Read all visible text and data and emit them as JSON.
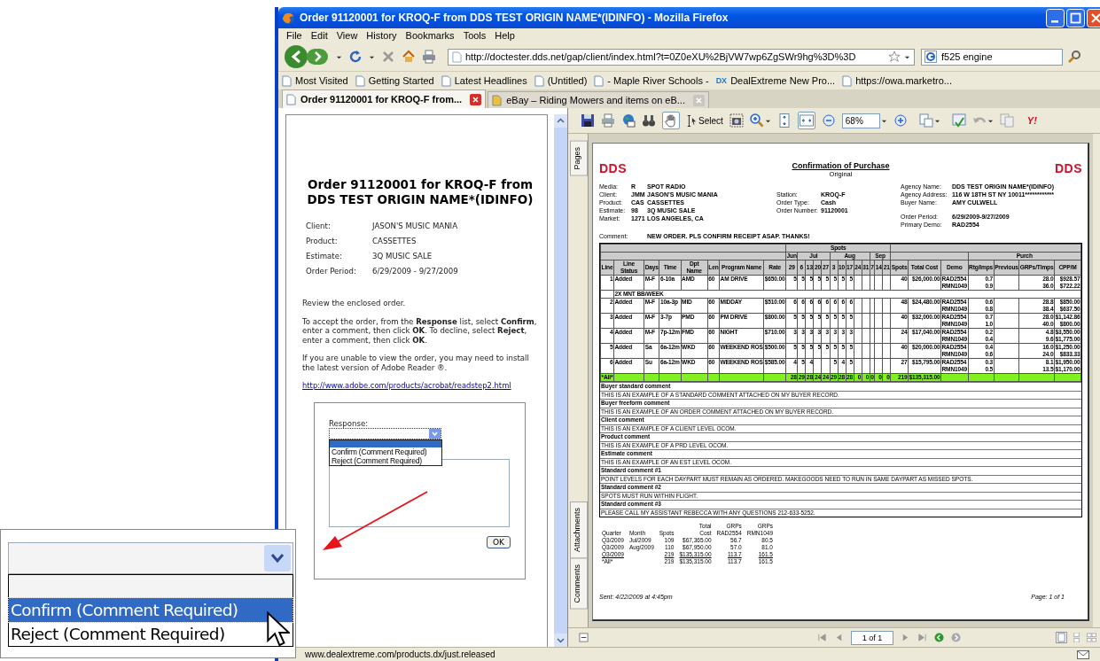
{
  "window": {
    "title": "Order 91120001 for KROQ-F from DDS TEST ORIGIN NAME*(IDINFO) - Mozilla Firefox"
  },
  "menu": [
    "File",
    "Edit",
    "View",
    "History",
    "Bookmarks",
    "Tools",
    "Help"
  ],
  "nav": {
    "url": "http://doctester.dds.net/gap/client/index.html?t=0Z0eXU%2BjVW7wp6ZgSWr9hg%3D%3D",
    "search": "f525 engine"
  },
  "bookmarks": [
    {
      "label": "Most Visited"
    },
    {
      "label": "Getting Started"
    },
    {
      "label": "Latest Headlines"
    },
    {
      "label": "(Untitled)"
    },
    {
      "label": "- Maple River Schools -"
    },
    {
      "label": "DealExtreme New Pro...",
      "badge": "DX"
    },
    {
      "label": "https://owa.marketro..."
    }
  ],
  "tabs": [
    {
      "label": "Order 91120001 for KROQ-F from...",
      "selected": true
    },
    {
      "label": "eBay – Riding Mowers and items on eB...",
      "selected": false
    }
  ],
  "order_page": {
    "heading": "Order 91120001 for KROQ-F from DDS TEST ORIGIN NAME*(IDINFO)",
    "fields": [
      {
        "label": "Client:",
        "value": "JASON'S MUSIC MANIA"
      },
      {
        "label": "Product:",
        "value": "CASSETTES"
      },
      {
        "label": "Estimate:",
        "value": "3Q MUSIC SALE"
      },
      {
        "label": "Order Period:",
        "value": "6/29/2009 - 9/27/2009"
      }
    ],
    "paragraphs": [
      "Review the enclosed order.",
      "To accept the order, from the **Response** list, select **Confirm**, enter a comment, then click **OK**. To decline, select **Reject**, enter a comment, then click **OK**.",
      "If you are unable to view the order, you may need to install the latest version of Adobe Reader ®."
    ],
    "link": "http://www.adobe.com/products/acrobat/readstep2.html",
    "response": {
      "label": "Response:",
      "blank_highlighted": true,
      "options": [
        {
          "label": "Confirm (Comment Required)",
          "selected": false
        },
        {
          "label": "Reject (Comment Required)",
          "selected": false
        }
      ],
      "button": "OK"
    }
  },
  "pdf_viewer": {
    "toolbar": {
      "hand_selected": true,
      "select_label": "Select",
      "fit_width_selected": true,
      "zoom": "68%",
      "logo": "Y!"
    },
    "side_tabs": [
      "Pages",
      "Attachments",
      "Comments"
    ],
    "page": {
      "logo_left": "DDS",
      "title": "Confirmation of Purchase",
      "subtitle": "Original",
      "logo_right": "DDS",
      "left_info": [
        {
          "label": "Media:",
          "code": "R",
          "value": "SPOT RADIO"
        },
        {
          "label": "Client:",
          "code": "JMM",
          "value": "JASON'S MUSIC MANIA"
        },
        {
          "label": "Product:",
          "code": "CAS",
          "value": "CASSETTES"
        },
        {
          "label": "Estimate:",
          "code": "98",
          "value": "3Q MUSIC SALE"
        },
        {
          "label": "Market:",
          "code": "1271",
          "value": "LOS ANGELES, CA"
        }
      ],
      "mid_info": [
        {
          "label": "Station:",
          "value": "KROQ-F"
        },
        {
          "label": "Order Type:",
          "value": "Cash"
        },
        {
          "label": "Order Number:",
          "value": "91120001"
        }
      ],
      "right_info": [
        {
          "label": "Agency Name:",
          "value": "DDS TEST ORIGIN NAME*(IDINFO)"
        },
        {
          "label": "Agency Address:",
          "value": "116 W 18TH ST NY 10011************"
        },
        {
          "label": "Buyer Name:",
          "value": "AMY CULWELL"
        },
        {
          "label": "Order Period:",
          "value": "6/29/2009-9/27/2009"
        },
        {
          "label": "Primary Demo:",
          "value": "RAD2554"
        }
      ],
      "comment_label": "Comment:",
      "comment": "NEW ORDER.  PLS CONFIRM RECEIPT ASAP.  THANKS!",
      "table": {
        "spots_group": "Spots",
        "purch_group": "Purch",
        "columns": [
          "Line",
          "Line Status",
          "Days",
          "Time",
          "Dpt Name",
          "Len",
          "Program Name",
          "Rate"
        ],
        "months": [
          {
            "label": "Jun",
            "weeks": [
              "29"
            ]
          },
          {
            "label": "Jul",
            "weeks": [
              "6",
              "13",
              "20",
              "27"
            ]
          },
          {
            "label": "Aug",
            "weeks": [
              "3",
              "10",
              "17",
              "24",
              "31"
            ]
          },
          {
            "label": "Sep",
            "weeks": [
              "7",
              "14",
              "21"
            ]
          }
        ],
        "tail_columns": [
          "Spots",
          "Total Cost",
          "Demo",
          "Rtg/Imps",
          "Previous",
          "GRPs/TImps",
          "CPP/M"
        ],
        "rows": [
          {
            "kind": "line",
            "cells": [
              "1",
              "Added",
              "M-F",
              "6-10a",
              "AMD",
              "60",
              "AM DRIVE",
              "$650.00"
            ],
            "weeks": [
              {
                "kind": "spots",
                "value": "5"
              },
              {
                "kind": "spots",
                "value": "5"
              },
              {
                "kind": "spots",
                "value": "5"
              },
              {
                "kind": "spots",
                "value": "5"
              },
              {
                "kind": "spots",
                "value": "5"
              },
              {
                "kind": "spots",
                "value": "5"
              },
              {
                "kind": "spots",
                "value": "5"
              },
              {
                "kind": "spots",
                "value": "5"
              },
              {
                "kind": "blank"
              },
              {
                "kind": "blank"
              },
              {
                "kind": "blank"
              },
              {
                "kind": "blank"
              },
              {
                "kind": "blank"
              }
            ],
            "spots": "40",
            "cost": "$26,000.00",
            "demos": [
              {
                "demo": "RAD2554",
                "rtg": "0.7",
                "grps": "28.0",
                "cpp": "$928.57"
              },
              {
                "demo": "RMN1049",
                "rtg": "0.9",
                "grps": "36.0",
                "cpp": "$722.22"
              }
            ],
            "note": "2X MNT BB/WEEK"
          },
          {
            "kind": "line",
            "cells": [
              "2",
              "Added",
              "M-F",
              "10a-3p",
              "MID",
              "60",
              "MIDDAY",
              "$510.00"
            ],
            "weeks": [
              {
                "kind": "spots",
                "value": "6"
              },
              {
                "kind": "spots",
                "value": "6"
              },
              {
                "kind": "spots",
                "value": "6"
              },
              {
                "kind": "spots",
                "value": "6"
              },
              {
                "kind": "spots",
                "value": "6"
              },
              {
                "kind": "spots",
                "value": "6"
              },
              {
                "kind": "spots",
                "value": "6"
              },
              {
                "kind": "spots",
                "value": "6"
              },
              {
                "kind": "blank"
              },
              {
                "kind": "blank"
              },
              {
                "kind": "blank"
              },
              {
                "kind": "blank"
              },
              {
                "kind": "blank"
              }
            ],
            "spots": "48",
            "cost": "$24,480.00",
            "demos": [
              {
                "demo": "RAD2554",
                "rtg": "0.6",
                "grps": "28.8",
                "cpp": "$850.00"
              },
              {
                "demo": "RMN1049",
                "rtg": "0.8",
                "grps": "38.4",
                "cpp": "$637.50"
              }
            ]
          },
          {
            "kind": "line",
            "cells": [
              "3",
              "Added",
              "M-F",
              "3-7p",
              "PMD",
              "60",
              "PM DRIVE",
              "$800.00"
            ],
            "weeks": [
              {
                "kind": "spots",
                "value": "5"
              },
              {
                "kind": "spots",
                "value": "5"
              },
              {
                "kind": "spots",
                "value": "5"
              },
              {
                "kind": "spots",
                "value": "5"
              },
              {
                "kind": "spots",
                "value": "5"
              },
              {
                "kind": "spots",
                "value": "5"
              },
              {
                "kind": "spots",
                "value": "5"
              },
              {
                "kind": "spots",
                "value": "5"
              },
              {
                "kind": "blank"
              },
              {
                "kind": "blank"
              },
              {
                "kind": "blank"
              },
              {
                "kind": "blank"
              },
              {
                "kind": "blank"
              }
            ],
            "spots": "40",
            "cost": "$32,000.00",
            "demos": [
              {
                "demo": "RAD2554",
                "rtg": "0.7",
                "grps": "28.0",
                "cpp": "$1,142.86"
              },
              {
                "demo": "RMN1049",
                "rtg": "1.0",
                "grps": "40.0",
                "cpp": "$800.00"
              }
            ]
          },
          {
            "kind": "line",
            "cells": [
              "4",
              "Added",
              "M-F",
              "7p-12m",
              "FMD",
              "60",
              "NIGHT",
              "$710.00"
            ],
            "weeks": [
              {
                "kind": "spots",
                "value": "3"
              },
              {
                "kind": "spots",
                "value": "3"
              },
              {
                "kind": "spots",
                "value": "3"
              },
              {
                "kind": "spots",
                "value": "3"
              },
              {
                "kind": "spots",
                "value": "3"
              },
              {
                "kind": "spots",
                "value": "3"
              },
              {
                "kind": "spots",
                "value": "3"
              },
              {
                "kind": "spots",
                "value": "3"
              },
              {
                "kind": "blank"
              },
              {
                "kind": "blank"
              },
              {
                "kind": "blank"
              },
              {
                "kind": "blank"
              },
              {
                "kind": "blank"
              }
            ],
            "spots": "24",
            "cost": "$17,040.00",
            "demos": [
              {
                "demo": "RAD2554",
                "rtg": "0.2",
                "grps": "4.8",
                "cpp": "$3,550.00"
              },
              {
                "demo": "RMN1049",
                "rtg": "0.4",
                "grps": "9.6",
                "cpp": "$1,775.00"
              }
            ]
          },
          {
            "kind": "line",
            "cells": [
              "5",
              "Added",
              "Sa",
              "6a-12m",
              "WKD",
              "60",
              "WEEKEND ROS",
              "$500.00"
            ],
            "weeks": [
              {
                "kind": "spots",
                "value": "5"
              },
              {
                "kind": "spots",
                "value": "5"
              },
              {
                "kind": "spots",
                "value": "5"
              },
              {
                "kind": "spots",
                "value": "5"
              },
              {
                "kind": "spots",
                "value": "5"
              },
              {
                "kind": "spots",
                "value": "5"
              },
              {
                "kind": "spots",
                "value": "5"
              },
              {
                "kind": "spots",
                "value": "5"
              },
              {
                "kind": "blank"
              },
              {
                "kind": "blank"
              },
              {
                "kind": "blank"
              },
              {
                "kind": "blank"
              },
              {
                "kind": "blank"
              }
            ],
            "spots": "40",
            "cost": "$20,000.00",
            "demos": [
              {
                "demo": "RAD2554",
                "rtg": "0.4",
                "grps": "16.0",
                "cpp": "$1,250.00"
              },
              {
                "demo": "RMN1049",
                "rtg": "0.6",
                "grps": "24.0",
                "cpp": "$833.33"
              }
            ]
          },
          {
            "kind": "line",
            "cells": [
              "6",
              "Added",
              "Su",
              "6a-12m",
              "WKD",
              "60",
              "WEEKEND ROS",
              "$585.00"
            ],
            "weeks": [
              {
                "kind": "spots",
                "value": "4"
              },
              {
                "kind": "spots",
                "value": "5"
              },
              {
                "kind": "spots",
                "value": "4"
              },
              {
                "kind": "blank"
              },
              {
                "kind": "blank"
              },
              {
                "kind": "spots",
                "value": "5"
              },
              {
                "kind": "spots",
                "value": "4"
              },
              {
                "kind": "spots",
                "value": "5"
              },
              {
                "kind": "blank"
              },
              {
                "kind": "blank"
              },
              {
                "kind": "blank"
              },
              {
                "kind": "blank"
              },
              {
                "kind": "blank"
              }
            ],
            "spots": "27",
            "cost": "$15,795.00",
            "demos": [
              {
                "demo": "RAD2554",
                "rtg": "0.3",
                "grps": "8.1",
                "cpp": "$1,950.00"
              },
              {
                "demo": "RMN1049",
                "rtg": "0.5",
                "grps": "13.5",
                "cpp": "$1,170.00"
              }
            ]
          },
          {
            "kind": "total",
            "cells": [
              "*All*"
            ],
            "weeks": [
              {
                "kind": "spots",
                "value": "28"
              },
              {
                "kind": "spots",
                "value": "29"
              },
              {
                "kind": "spots",
                "value": "28"
              },
              {
                "kind": "spots",
                "value": "24"
              },
              {
                "kind": "spots",
                "value": "24"
              },
              {
                "kind": "spots",
                "value": "29"
              },
              {
                "kind": "spots",
                "value": "28"
              },
              {
                "kind": "spots",
                "value": "28"
              },
              {
                "kind": "spots",
                "value": "0"
              },
              {
                "kind": "spots",
                "value": "0"
              },
              {
                "kind": "spots",
                "value": "0"
              },
              {
                "kind": "spots",
                "value": "0"
              },
              {
                "kind": "spots",
                "value": "0"
              }
            ],
            "spots": "219",
            "cost": "$135,315.00"
          }
        ]
      },
      "comments": [
        {
          "label": "Buyer standard comment",
          "text": "THIS IS AN EXAMPLE OF A STANDARD COMMENT ATTACHED ON MY BUYER RECORD."
        },
        {
          "label": "Buyer freeform comment",
          "text": "THIS IS AN EXAMPLE OF AN ORDER COMMENT ATTACHED ON MY BUYER RECORD."
        },
        {
          "label": "Client comment",
          "text": "THIS IS AN EXAMPLE OF A CLIENT LEVEL OCOM."
        },
        {
          "label": "Product comment",
          "text": "THIS IS AN EXAMPLE OF A PRD LEVEL OCOM."
        },
        {
          "label": "Estimate comment",
          "text": "THIS IS AN EXAMPLE OF AN EST LEVEL OCOM."
        },
        {
          "label": "Standard comment #1",
          "text": "POINT LEVELS FOR EACH DAYPART MUST REMAIN AS ORDERED. MAKEGOODS NEED TO RUN IN SAME DAYPART AS MISSED SPOTS."
        },
        {
          "label": "Standard comment #2",
          "text": "SPOTS MUST RUN WITHIN FLIGHT."
        },
        {
          "label": "Standard comment #3",
          "text": "PLEASE CALL MY ASSISTANT REBECCA WITH ANY QUESTIONS 212-633-5252."
        }
      ],
      "summary": {
        "columns": [
          "Quarter",
          "Month",
          "Spots",
          "Total Cost",
          "GRPs RAD2554",
          "GRPs RMN1049"
        ],
        "rows": [
          {
            "quarter": "Q3/2009",
            "month": "Jul/2009",
            "spots": "109",
            "cost": "$67,365.00",
            "grps_rad": "56.7",
            "grps_rmn": "80.5"
          },
          {
            "quarter": "Q3/2009",
            "month": "Aug/2009",
            "spots": "110",
            "cost": "$67,950.00",
            "grps_rad": "57.0",
            "grps_rmn": "81.0"
          },
          {
            "quarter": "Q3/2009",
            "spots": "219",
            "cost": "$135,315.00",
            "grps_rad": "113.7",
            "grps_rmn": "161.5"
          },
          {
            "quarter": "*All*",
            "spots": "219",
            "cost": "$135,315.00",
            "grps_rad": "113.7",
            "grps_rmn": "161.5"
          }
        ]
      },
      "sent": "Sent: 4/22/2009 at 4:45pm",
      "page_number": "Page: 1 of 1"
    },
    "page_field": "1 of 1"
  },
  "status_bar": "www.dealextreme.com/products.dx/just.released",
  "inset": {
    "blank_highlighted": false,
    "options": [
      {
        "label": "Confirm (Comment Required)",
        "selected": true
      },
      {
        "label": "Reject (Comment Required)",
        "selected": false
      }
    ]
  }
}
